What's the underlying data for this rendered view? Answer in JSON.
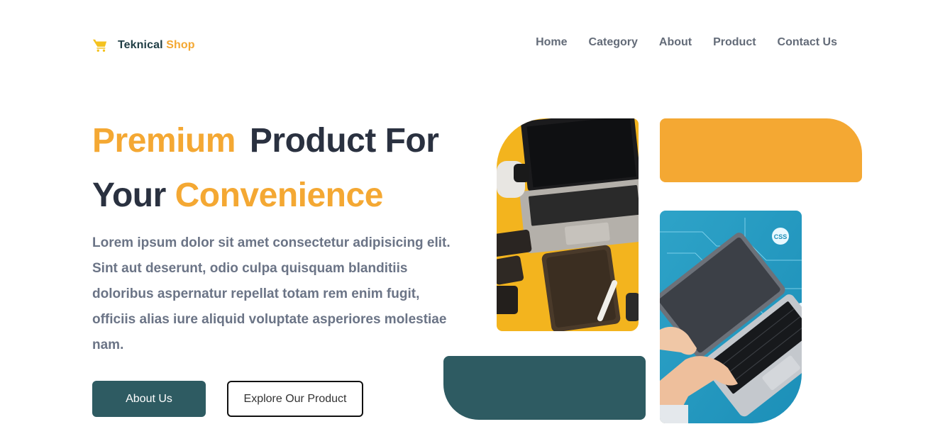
{
  "brand": {
    "name_part1": "Teknical",
    "name_part2": "Shop",
    "icon": "shopping-cart-icon"
  },
  "nav": {
    "items": [
      "Home",
      "Category",
      "About",
      "Product",
      "Contact Us"
    ]
  },
  "hero": {
    "headline_word1": "Premium",
    "headline_word2": "Product For",
    "headline_word3": "Your",
    "headline_word4": "Convenience",
    "description": "Lorem ipsum dolor sit amet consectetur adipisicing elit. Sint aut deserunt, odio culpa quisquam blanditiis doloribus aspernatur repellat totam rem enim fugit, officiis alias iure aliquid voluptate asperiores molestiae nam.",
    "primary_button": "About Us",
    "secondary_button": "Explore Our Product"
  },
  "colors": {
    "accent": "#f4a833",
    "primary": "#2e5b62",
    "heading": "#2a3140",
    "body_text": "#6b7486"
  }
}
